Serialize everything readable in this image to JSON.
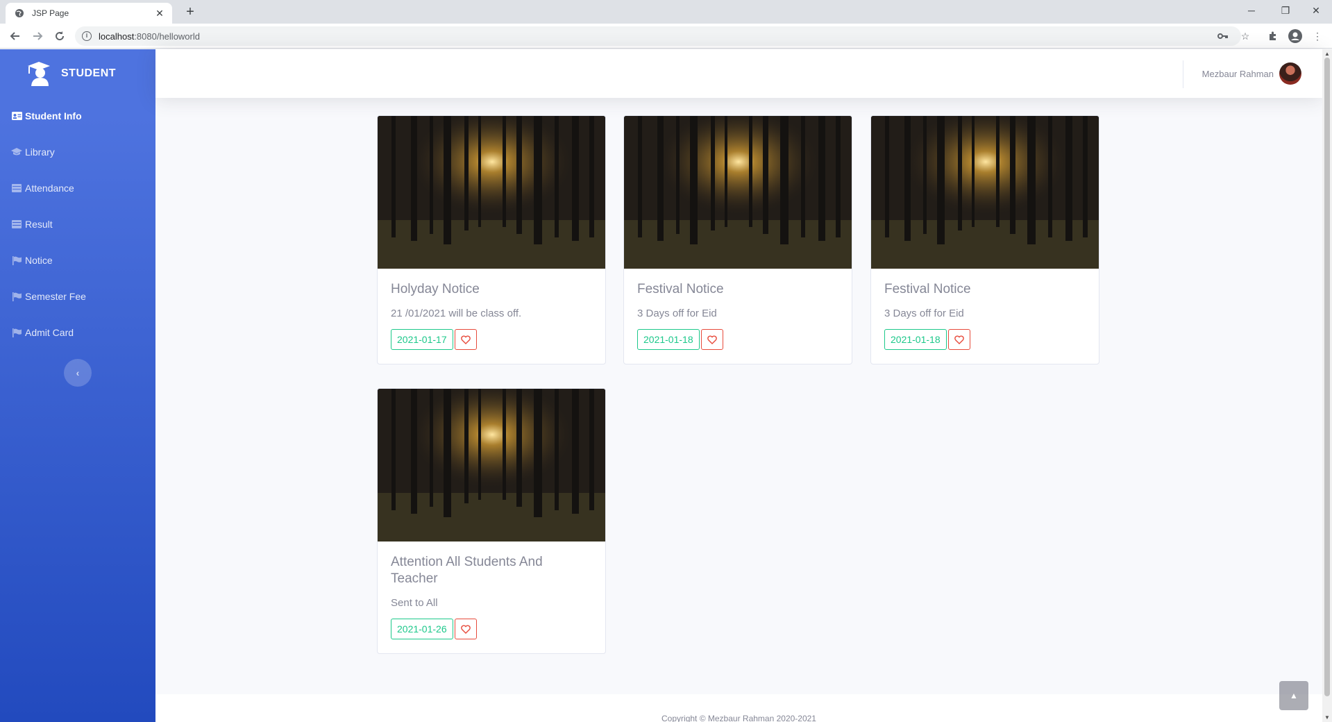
{
  "browser": {
    "tab_title": "JSP Page",
    "url_host": "localhost",
    "url_path": ":8080/helloworld"
  },
  "sidebar": {
    "brand": "STUDENT",
    "items": [
      {
        "label": "Student Info",
        "icon": "id-card-icon",
        "active": true
      },
      {
        "label": "Library",
        "icon": "graduation-cap-icon"
      },
      {
        "label": "Attendance",
        "icon": "table-icon"
      },
      {
        "label": "Result",
        "icon": "table-icon"
      },
      {
        "label": "Notice",
        "icon": "flag-icon"
      },
      {
        "label": "Semester Fee",
        "icon": "flag-icon"
      },
      {
        "label": "Admit Card",
        "icon": "flag-icon"
      }
    ]
  },
  "topbar": {
    "username": "Mezbaur Rahman"
  },
  "notices": [
    {
      "title": "Holyday Notice",
      "text": "21 /01/2021 will be class off.",
      "date": "2021-01-17"
    },
    {
      "title": "Festival Notice",
      "text": "3 Days off for Eid",
      "date": "2021-01-18"
    },
    {
      "title": "Festival Notice",
      "text": "3 Days off for Eid",
      "date": "2021-01-18"
    },
    {
      "title": "Attention All Students And Teacher",
      "text": "Sent to All",
      "date": "2021-01-26"
    }
  ],
  "footer": {
    "copyright": "Copyright © Mezbaur Rahman 2020-2021"
  },
  "colors": {
    "sidebar_top": "#4e73df",
    "sidebar_bottom": "#224abe",
    "success": "#1cc88a",
    "danger": "#e74a3b"
  }
}
